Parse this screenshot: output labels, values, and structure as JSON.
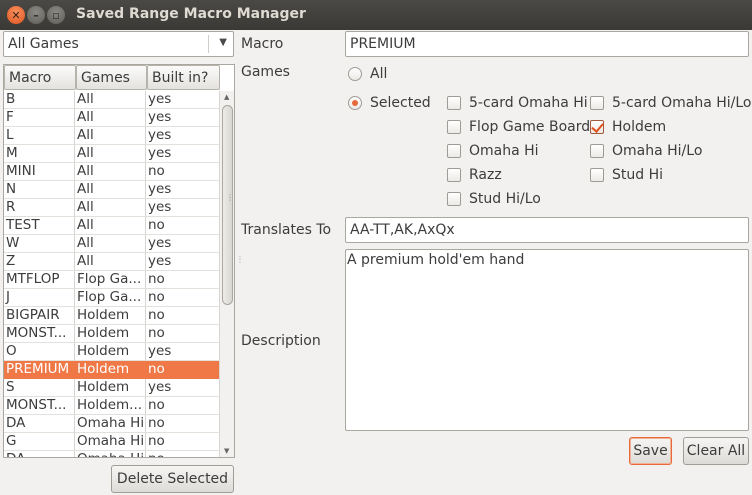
{
  "window": {
    "title": "Saved Range Macro Manager"
  },
  "filter": {
    "selected": "All Games"
  },
  "table": {
    "columns": [
      "Macro",
      "Games",
      "Built in?"
    ],
    "rows": [
      {
        "macro": "B",
        "games": "All",
        "builtin": "yes"
      },
      {
        "macro": "F",
        "games": "All",
        "builtin": "yes"
      },
      {
        "macro": "L",
        "games": "All",
        "builtin": "yes"
      },
      {
        "macro": "M",
        "games": "All",
        "builtin": "yes"
      },
      {
        "macro": "MINI",
        "games": "All",
        "builtin": "no"
      },
      {
        "macro": "N",
        "games": "All",
        "builtin": "yes"
      },
      {
        "macro": "R",
        "games": "All",
        "builtin": "yes"
      },
      {
        "macro": "TEST",
        "games": "All",
        "builtin": "no"
      },
      {
        "macro": "W",
        "games": "All",
        "builtin": "yes"
      },
      {
        "macro": "Z",
        "games": "All",
        "builtin": "yes"
      },
      {
        "macro": "MTFLOP",
        "games": "Flop Ga...",
        "builtin": "no"
      },
      {
        "macro": "J",
        "games": "Flop Ga...",
        "builtin": "no"
      },
      {
        "macro": "BIGPAIR",
        "games": "Holdem",
        "builtin": "no"
      },
      {
        "macro": "MONST...",
        "games": "Holdem",
        "builtin": "no"
      },
      {
        "macro": "O",
        "games": "Holdem",
        "builtin": "yes"
      },
      {
        "macro": "PREMIUM",
        "games": "Holdem",
        "builtin": "no",
        "selected": true
      },
      {
        "macro": "S",
        "games": "Holdem",
        "builtin": "yes"
      },
      {
        "macro": "MONST...",
        "games": "Holdem...",
        "builtin": "no"
      },
      {
        "macro": "DA",
        "games": "Omaha Hi",
        "builtin": "no"
      },
      {
        "macro": "G",
        "games": "Omaha Hi",
        "builtin": "no"
      },
      {
        "macro": "DA",
        "games": "Omaha Hi",
        "builtin": "no"
      }
    ]
  },
  "buttons": {
    "delete_selected": "Delete Selected",
    "save": "Save",
    "clear_all": "Clear All"
  },
  "form": {
    "macro_label": "Macro",
    "macro_value": "PREMIUM",
    "games_label": "Games",
    "radio_all": "All",
    "radio_selected": "Selected",
    "games_options": [
      {
        "label": "5-card Omaha Hi",
        "checked": false
      },
      {
        "label": "5-card Omaha Hi/Lo",
        "checked": false
      },
      {
        "label": "Flop Game Board",
        "checked": false
      },
      {
        "label": "Holdem",
        "checked": true
      },
      {
        "label": "Omaha Hi",
        "checked": false
      },
      {
        "label": "Omaha Hi/Lo",
        "checked": false
      },
      {
        "label": "Razz",
        "checked": false
      },
      {
        "label": "Stud Hi",
        "checked": false
      },
      {
        "label": "Stud Hi/Lo",
        "checked": false
      }
    ],
    "translates_label": "Translates To",
    "translates_value": "AA-TT,AK,AxQx",
    "description_label": "Description",
    "description_value": "A premium hold'em hand"
  },
  "colors": {
    "accent": "#f07746",
    "titlebar": "#3c3b37"
  }
}
